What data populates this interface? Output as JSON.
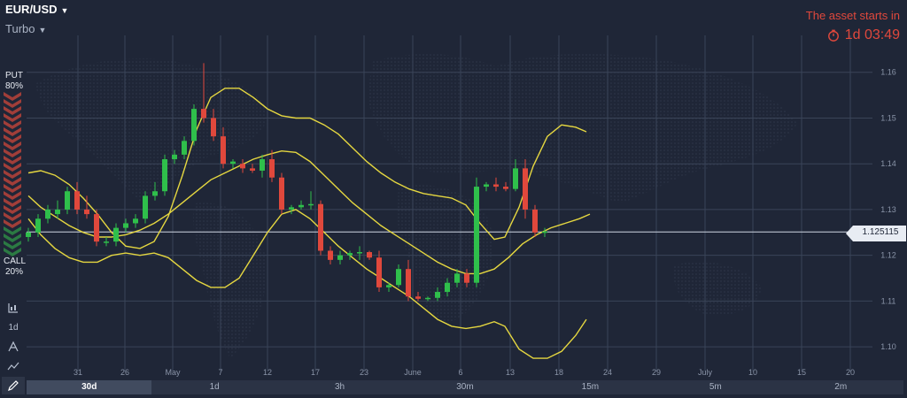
{
  "header": {
    "asset": "EUR/USD",
    "mode": "Turbo",
    "start_label": "The asset starts in",
    "countdown": "1d 03:49"
  },
  "sentiment": {
    "put_label": "PUT",
    "put_pct": "80%",
    "call_label": "CALL",
    "call_pct": "20%"
  },
  "tools": [
    {
      "name": "chart-type-icon"
    },
    {
      "name": "timeframe",
      "label": "1d"
    },
    {
      "name": "indicators-icon"
    },
    {
      "name": "trend-lines-icon"
    },
    {
      "name": "draw-pencil-icon"
    }
  ],
  "current_price": "1.125115",
  "timeframes": [
    "30d",
    "1d",
    "3h",
    "30m",
    "15m",
    "5m",
    "2m"
  ],
  "active_timeframe": "30d",
  "chart_data": {
    "type": "candlestick",
    "x_ticks": [
      "31",
      "26",
      "May",
      "7",
      "12",
      "17",
      "23",
      "June",
      "6",
      "13",
      "18",
      "24",
      "29",
      "July",
      "10",
      "15",
      "20"
    ],
    "y_ticks": [
      1.16,
      1.15,
      1.14,
      1.13,
      1.12,
      1.11,
      1.1
    ],
    "y_range": [
      1.095,
      1.17
    ],
    "colors": {
      "up": "#2fbf4b",
      "down": "#e0483c",
      "bands": "#e5d740"
    },
    "candles": [
      [
        1.124,
        1.126,
        1.123,
        1.125
      ],
      [
        1.125,
        1.129,
        1.124,
        1.128
      ],
      [
        1.128,
        1.131,
        1.127,
        1.13
      ],
      [
        1.129,
        1.132,
        1.128,
        1.13
      ],
      [
        1.13,
        1.135,
        1.129,
        1.134
      ],
      [
        1.134,
        1.136,
        1.129,
        1.13
      ],
      [
        1.13,
        1.133,
        1.128,
        1.129
      ],
      [
        1.129,
        1.13,
        1.122,
        1.123
      ],
      [
        1.123,
        1.124,
        1.122,
        1.123
      ],
      [
        1.123,
        1.127,
        1.122,
        1.126
      ],
      [
        1.126,
        1.128,
        1.125,
        1.127
      ],
      [
        1.127,
        1.129,
        1.126,
        1.128
      ],
      [
        1.128,
        1.134,
        1.127,
        1.133
      ],
      [
        1.133,
        1.136,
        1.132,
        1.134
      ],
      [
        1.134,
        1.142,
        1.133,
        1.141
      ],
      [
        1.141,
        1.143,
        1.14,
        1.142
      ],
      [
        1.142,
        1.146,
        1.141,
        1.145
      ],
      [
        1.145,
        1.153,
        1.144,
        1.152
      ],
      [
        1.152,
        1.162,
        1.149,
        1.15
      ],
      [
        1.15,
        1.152,
        1.145,
        1.146
      ],
      [
        1.146,
        1.148,
        1.139,
        1.14
      ],
      [
        1.14,
        1.141,
        1.139,
        1.1405
      ],
      [
        1.14,
        1.141,
        1.138,
        1.139
      ],
      [
        1.139,
        1.14,
        1.138,
        1.1385
      ],
      [
        1.1385,
        1.142,
        1.137,
        1.141
      ],
      [
        1.141,
        1.143,
        1.136,
        1.137
      ],
      [
        1.137,
        1.138,
        1.129,
        1.13
      ],
      [
        1.13,
        1.131,
        1.129,
        1.1305
      ],
      [
        1.1305,
        1.132,
        1.13,
        1.131
      ],
      [
        1.131,
        1.134,
        1.13,
        1.1312
      ],
      [
        1.1312,
        1.132,
        1.12,
        1.121
      ],
      [
        1.121,
        1.122,
        1.118,
        1.119
      ],
      [
        1.119,
        1.121,
        1.118,
        1.12
      ],
      [
        1.12,
        1.121,
        1.119,
        1.1205
      ],
      [
        1.1205,
        1.122,
        1.119,
        1.1207
      ],
      [
        1.1207,
        1.121,
        1.119,
        1.1195
      ],
      [
        1.1195,
        1.121,
        1.112,
        1.113
      ],
      [
        1.113,
        1.114,
        1.112,
        1.1135
      ],
      [
        1.1135,
        1.118,
        1.113,
        1.117
      ],
      [
        1.117,
        1.119,
        1.11,
        1.111
      ],
      [
        1.111,
        1.112,
        1.11,
        1.1105
      ],
      [
        1.1105,
        1.111,
        1.11,
        1.1107
      ],
      [
        1.1107,
        1.113,
        1.11,
        1.112
      ],
      [
        1.112,
        1.115,
        1.111,
        1.114
      ],
      [
        1.114,
        1.117,
        1.113,
        1.116
      ],
      [
        1.116,
        1.117,
        1.113,
        1.114
      ],
      [
        1.114,
        1.137,
        1.113,
        1.135
      ],
      [
        1.135,
        1.136,
        1.134,
        1.1355
      ],
      [
        1.1355,
        1.137,
        1.134,
        1.135
      ],
      [
        1.135,
        1.136,
        1.134,
        1.1345
      ],
      [
        1.1345,
        1.141,
        1.134,
        1.139
      ],
      [
        1.139,
        1.141,
        1.128,
        1.13
      ],
      [
        1.13,
        1.131,
        1.124,
        1.125
      ],
      [
        1.125,
        1.126,
        1.124,
        1.1252
      ]
    ],
    "bands_upper": [
      [
        1,
        1.138
      ],
      [
        8,
        1.1385
      ],
      [
        16,
        1.1375
      ],
      [
        24,
        1.1355
      ],
      [
        32,
        1.1325
      ],
      [
        40,
        1.129
      ],
      [
        48,
        1.125
      ],
      [
        56,
        1.122
      ],
      [
        64,
        1.1215
      ],
      [
        72,
        1.123
      ],
      [
        80,
        1.1285
      ],
      [
        88,
        1.1375
      ],
      [
        96,
        1.1475
      ],
      [
        104,
        1.1545
      ],
      [
        112,
        1.1565
      ],
      [
        120,
        1.1565
      ],
      [
        128,
        1.1545
      ],
      [
        136,
        1.152
      ],
      [
        144,
        1.1505
      ],
      [
        152,
        1.15
      ],
      [
        160,
        1.15
      ],
      [
        168,
        1.1485
      ],
      [
        176,
        1.1465
      ],
      [
        184,
        1.1435
      ],
      [
        192,
        1.1405
      ],
      [
        200,
        1.138
      ],
      [
        208,
        1.136
      ],
      [
        216,
        1.1345
      ],
      [
        224,
        1.1335
      ],
      [
        232,
        1.133
      ],
      [
        240,
        1.1325
      ],
      [
        248,
        1.131
      ],
      [
        256,
        1.127
      ],
      [
        264,
        1.1235
      ],
      [
        270,
        1.124
      ],
      [
        278,
        1.1305
      ],
      [
        286,
        1.1395
      ],
      [
        294,
        1.146
      ],
      [
        302,
        1.1485
      ],
      [
        310,
        1.148
      ],
      [
        316,
        1.147
      ]
    ],
    "bands_middle": [
      [
        1,
        1.133
      ],
      [
        8,
        1.1305
      ],
      [
        16,
        1.1285
      ],
      [
        24,
        1.1265
      ],
      [
        32,
        1.125
      ],
      [
        40,
        1.124
      ],
      [
        48,
        1.124
      ],
      [
        56,
        1.1245
      ],
      [
        64,
        1.1255
      ],
      [
        72,
        1.127
      ],
      [
        80,
        1.129
      ],
      [
        88,
        1.1315
      ],
      [
        96,
        1.134
      ],
      [
        104,
        1.1365
      ],
      [
        112,
        1.138
      ],
      [
        120,
        1.1395
      ],
      [
        128,
        1.141
      ],
      [
        136,
        1.142
      ],
      [
        144,
        1.1428
      ],
      [
        152,
        1.1425
      ],
      [
        160,
        1.1405
      ],
      [
        168,
        1.1375
      ],
      [
        176,
        1.1345
      ],
      [
        184,
        1.1315
      ],
      [
        192,
        1.129
      ],
      [
        200,
        1.1265
      ],
      [
        208,
        1.1245
      ],
      [
        216,
        1.1225
      ],
      [
        224,
        1.1205
      ],
      [
        232,
        1.1185
      ],
      [
        240,
        1.117
      ],
      [
        248,
        1.116
      ],
      [
        256,
        1.116
      ],
      [
        264,
        1.117
      ],
      [
        272,
        1.1195
      ],
      [
        280,
        1.1225
      ],
      [
        288,
        1.1245
      ],
      [
        296,
        1.126
      ],
      [
        304,
        1.127
      ],
      [
        312,
        1.128
      ],
      [
        318,
        1.129
      ]
    ],
    "bands_lower": [
      [
        1,
        1.128
      ],
      [
        8,
        1.1245
      ],
      [
        16,
        1.1215
      ],
      [
        24,
        1.1195
      ],
      [
        32,
        1.1185
      ],
      [
        40,
        1.1185
      ],
      [
        48,
        1.12
      ],
      [
        56,
        1.1205
      ],
      [
        64,
        1.12
      ],
      [
        72,
        1.1205
      ],
      [
        80,
        1.1195
      ],
      [
        88,
        1.117
      ],
      [
        96,
        1.1145
      ],
      [
        104,
        1.113
      ],
      [
        112,
        1.113
      ],
      [
        120,
        1.115
      ],
      [
        128,
        1.12
      ],
      [
        136,
        1.125
      ],
      [
        144,
        1.129
      ],
      [
        152,
        1.13
      ],
      [
        160,
        1.128
      ],
      [
        168,
        1.125
      ],
      [
        176,
        1.122
      ],
      [
        184,
        1.1195
      ],
      [
        192,
        1.117
      ],
      [
        200,
        1.115
      ],
      [
        208,
        1.113
      ],
      [
        216,
        1.111
      ],
      [
        224,
        1.1085
      ],
      [
        232,
        1.106
      ],
      [
        240,
        1.1045
      ],
      [
        248,
        1.104
      ],
      [
        256,
        1.1045
      ],
      [
        264,
        1.1055
      ],
      [
        270,
        1.1045
      ],
      [
        278,
        1.0995
      ],
      [
        286,
        1.0975
      ],
      [
        294,
        1.0975
      ],
      [
        302,
        1.099
      ],
      [
        310,
        1.1025
      ],
      [
        316,
        1.106
      ]
    ]
  }
}
